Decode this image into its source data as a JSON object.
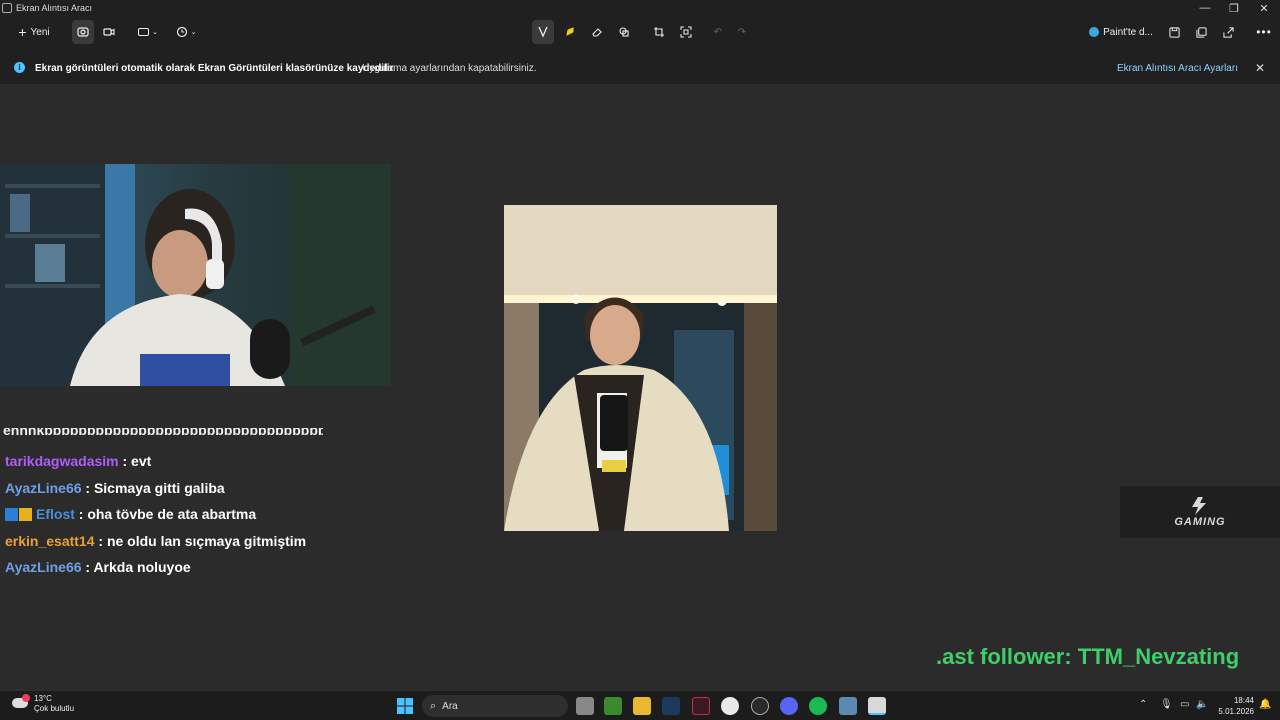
{
  "window": {
    "title": "Ekran Alıntısı Aracı"
  },
  "toolbar": {
    "new_label": "Yeni",
    "paint_label": "Paint'te d..."
  },
  "info_bar": {
    "title": "Ekran görüntüleri otomatik olarak Ekran Görüntüleri klasörünüze kaydedilir",
    "text": "Uygulama ayarlarından kapatabilirsiniz.",
    "link": "Ekran Alıntısı Aracı Ayarları"
  },
  "chat": {
    "cut_line": "ennnkbbbbbbbbbbbbbbbbbbbbbbbbbbbbbbbbb",
    "messages": [
      {
        "user": "tarikdagwadasim",
        "text": ": evt",
        "color": "#b05cff"
      },
      {
        "user": "AyazLine66",
        "text": ": Sicmaya gitti galiba",
        "color": "#6ea0e6"
      },
      {
        "user": "Eflost",
        "text": ": oha tövbe de ata abartma",
        "color": "#4a8fd8"
      },
      {
        "user": "erkin_esatt14",
        "text": ": ne oldu lan sıçmaya gitmiştim",
        "color": "#e8a13a"
      },
      {
        "user": "AyazLine66",
        "text": ": Arkda noluyoe",
        "color": "#6ea0e6"
      }
    ]
  },
  "overlay": {
    "logo_text": "GAMING",
    "follower": ".ast follower: TTM_Nevzating"
  },
  "taskbar": {
    "weather_temp": "13°C",
    "weather_desc": "Çok bulutlu",
    "search_placeholder": "Ara",
    "time": "18:44",
    "date": "5.01.2026"
  }
}
